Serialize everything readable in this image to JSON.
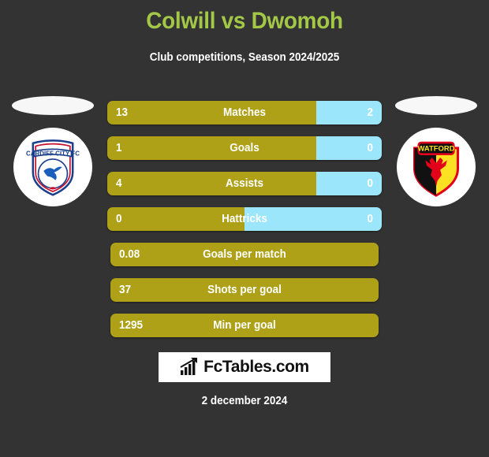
{
  "header": {
    "title": "Colwill vs Dwomoh",
    "subtitle": "Club competitions, Season 2024/2025",
    "title_color": "#a3c847"
  },
  "teams": {
    "home": {
      "name": "Cardiff City FC",
      "crest_text": "CARDIFF CITY FC",
      "icon": "cardiff-city-crest-icon"
    },
    "away": {
      "name": "Watford",
      "crest_text": "WATFORD",
      "icon": "watford-crest-icon"
    }
  },
  "colors": {
    "background": "#333333",
    "home_bar": "#aea017",
    "away_bar": "#9be6fa",
    "accent": "#a3c847"
  },
  "stats": [
    {
      "label": "Matches",
      "home": "13",
      "away": "2",
      "home_pct": 76.1,
      "split": true
    },
    {
      "label": "Goals",
      "home": "1",
      "away": "0",
      "home_pct": 76.1,
      "split": true
    },
    {
      "label": "Assists",
      "home": "4",
      "away": "0",
      "home_pct": 76.1,
      "split": true
    },
    {
      "label": "Hattricks",
      "home": "0",
      "away": "0",
      "home_pct": 50.0,
      "split": true
    },
    {
      "label": "Goals per match",
      "home": "0.08",
      "away": "",
      "home_pct": 100,
      "split": false
    },
    {
      "label": "Shots per goal",
      "home": "37",
      "away": "",
      "home_pct": 100,
      "split": false
    },
    {
      "label": "Min per goal",
      "home": "1295",
      "away": "",
      "home_pct": 100,
      "split": false
    }
  ],
  "footer": {
    "brand": "FcTables.com",
    "brand_icon": "bar-chart-arrow-icon",
    "date": "2 december 2024"
  }
}
